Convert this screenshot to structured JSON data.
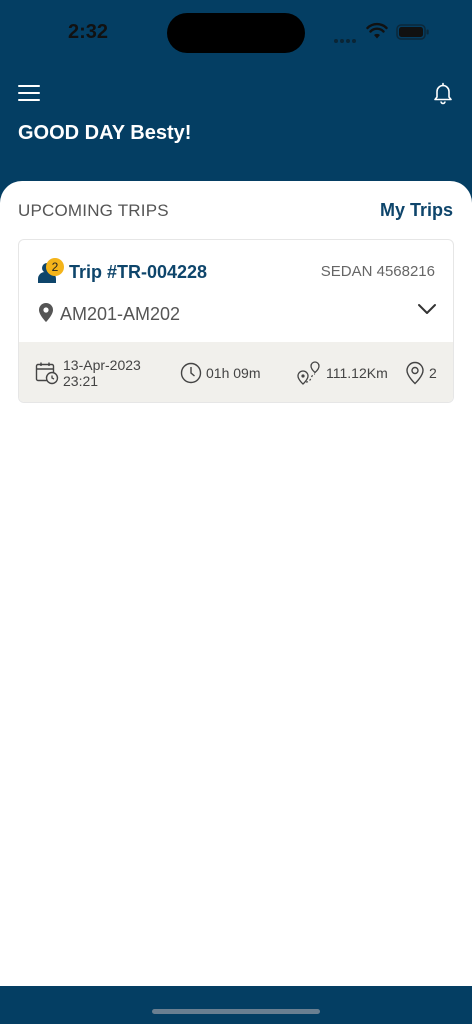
{
  "status_bar": {
    "time": "2:32"
  },
  "header": {
    "greeting": "GOOD DAY Besty!"
  },
  "upcoming": {
    "section_title": "UPCOMING TRIPS",
    "my_trips_link": "My Trips"
  },
  "trip": {
    "passenger_count": "2",
    "trip_id": "Trip #TR-004228",
    "vehicle": "SEDAN 4568216",
    "route": "AM201-AM202",
    "date": "13-Apr-2023",
    "time": "23:21",
    "duration": "01h 09m",
    "distance": "111.12Km",
    "stops": "2"
  },
  "colors": {
    "primary": "#043e63",
    "accent_text": "#0e456b",
    "badge": "#f4b41a",
    "card_footer_bg": "#f1f0ec"
  }
}
